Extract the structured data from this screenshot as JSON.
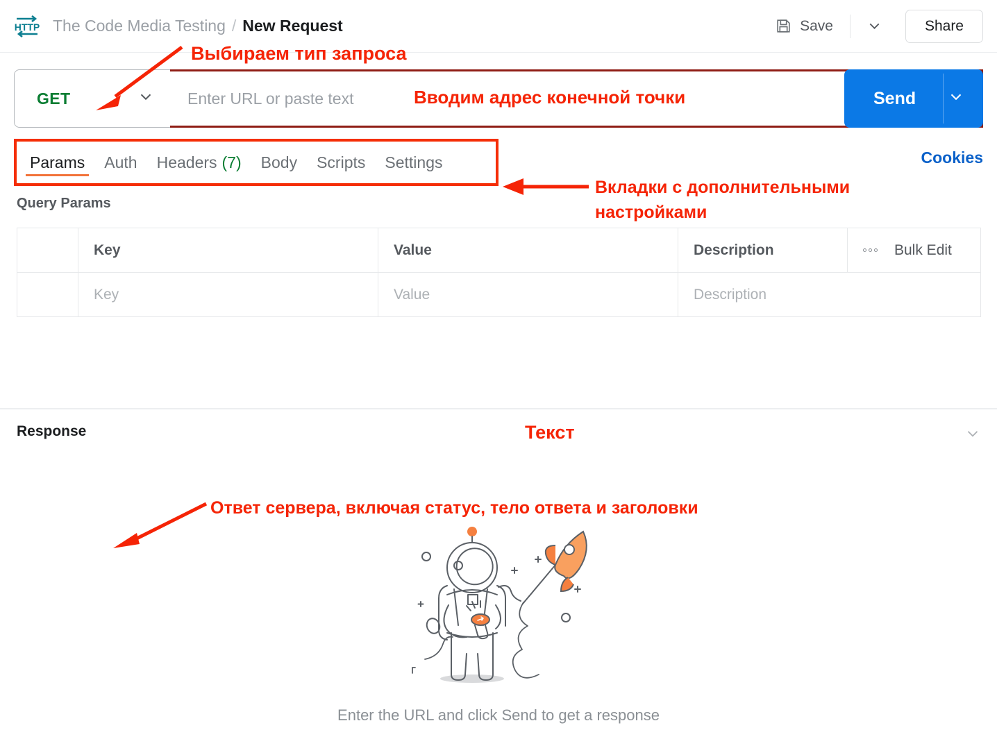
{
  "header": {
    "logo_icon": "http-icon",
    "collection": "The Code Media Testing",
    "separator": "/",
    "request_name": "New Request",
    "save_label": "Save",
    "save_icon": "floppy-disk-icon",
    "save_dropdown_icon": "chevron-down-icon",
    "share_label": "Share"
  },
  "urlbar": {
    "method": "GET",
    "method_dropdown_icon": "chevron-down-icon",
    "url_placeholder": "Enter URL or paste text",
    "url_value": "",
    "warning_icon": "exclamation-circle-icon",
    "send_label": "Send",
    "send_dropdown_icon": "chevron-down-icon"
  },
  "tabs": {
    "items": [
      {
        "label": "Params",
        "count": "",
        "active": true
      },
      {
        "label": "Auth",
        "count": "",
        "active": false
      },
      {
        "label": "Headers",
        "count": "(7)",
        "active": false
      },
      {
        "label": "Body",
        "count": "",
        "active": false
      },
      {
        "label": "Scripts",
        "count": "",
        "active": false
      },
      {
        "label": "Settings",
        "count": "",
        "active": false
      }
    ],
    "cookies_label": "Cookies"
  },
  "query_params": {
    "title": "Query Params",
    "headers": {
      "key": "Key",
      "value": "Value",
      "description": "Description",
      "bulk_edit": "Bulk Edit",
      "bulk_icon": "more-options-icon"
    },
    "rows": [
      {
        "key_placeholder": "Key",
        "value_placeholder": "Value",
        "description_placeholder": "Description"
      }
    ]
  },
  "response": {
    "label": "Response",
    "collapse_icon": "chevron-down-icon",
    "illustration": "astronaut-with-rocket-illustration",
    "hint": "Enter the URL and click Send to get a response"
  },
  "annotations": {
    "method": "Выбираем тип запроса",
    "url": "Вводим адрес конечной точки",
    "tabs": "Вкладки с дополнительными настройками",
    "response_text": "Текст",
    "response": "Ответ сервера, включая статус, тело ответа и заголовки"
  },
  "colors": {
    "annotation_red": "#f52406",
    "highlight_box_red": "#f52e06",
    "url_box_red": "#8f1d15",
    "send_blue": "#0b79e6",
    "method_green": "#0a7d32",
    "link_blue": "#0b61c9",
    "active_tab_underline": "#f2733a",
    "http_icon_teal": "#0c7f91"
  }
}
